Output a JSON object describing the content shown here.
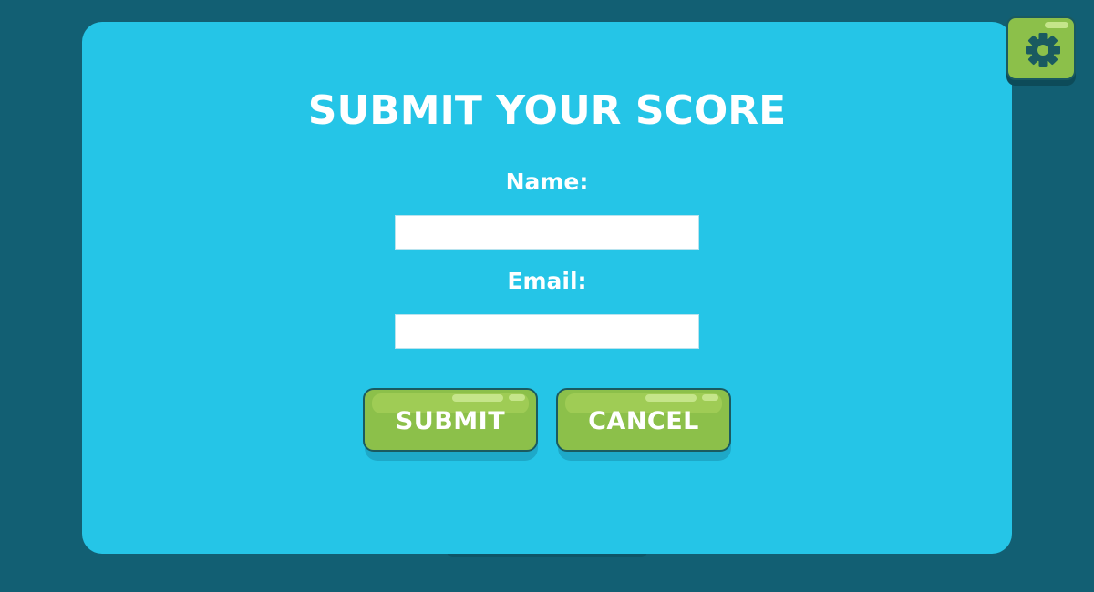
{
  "dialog": {
    "title": "SUBMIT YOUR SCORE",
    "name_label": "Name:",
    "name_value": "",
    "email_label": "Email:",
    "email_value": ""
  },
  "buttons": {
    "submit_label": "SUBMIT",
    "cancel_label": "CANCEL",
    "settings_icon": "gear-icon"
  },
  "colors": {
    "background": "#125f73",
    "panel": "#25c5e7",
    "button_green": "#8cc04a",
    "button_border": "#1a5a60",
    "text": "#ffffff"
  }
}
